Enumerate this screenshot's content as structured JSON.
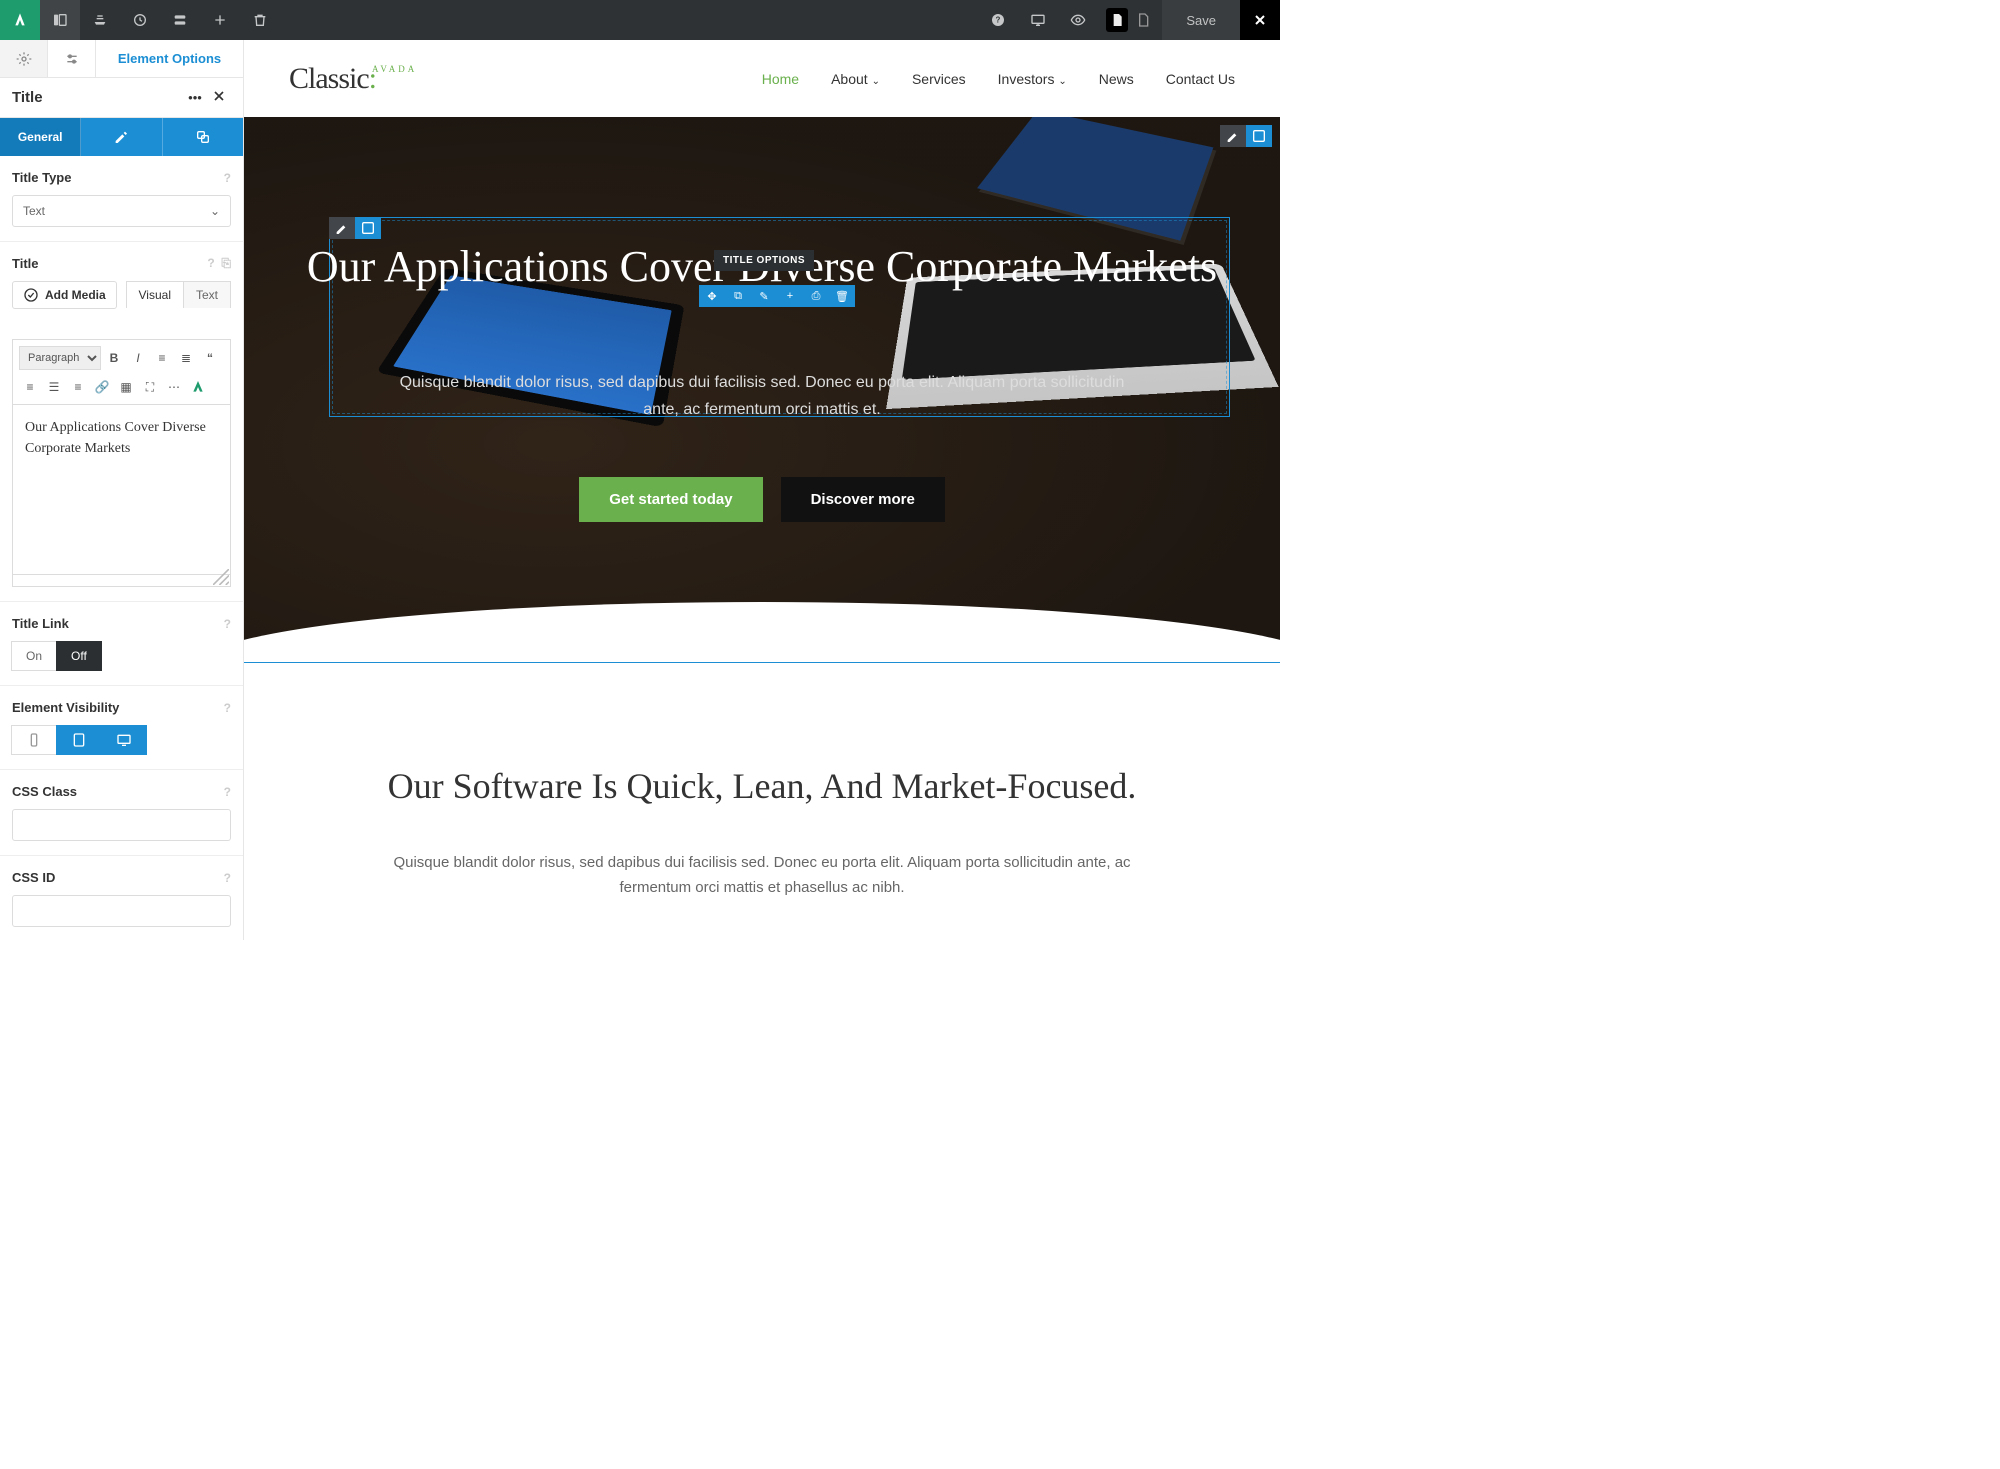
{
  "topbar": {
    "save": "Save"
  },
  "sidebar": {
    "elementOptionsTab": "Element Options",
    "title": "Title",
    "generalTab": "General",
    "fields": {
      "titleType": {
        "label": "Title Type",
        "value": "Text"
      },
      "titleEditor": {
        "label": "Title",
        "addMedia": "Add Media",
        "visual": "Visual",
        "text": "Text",
        "paragraph": "Paragraph",
        "content": "Our Applications Cover Diverse Corporate Markets"
      },
      "titleLink": {
        "label": "Title Link",
        "on": "On",
        "off": "Off"
      },
      "visibility": {
        "label": "Element Visibility"
      },
      "cssClass": {
        "label": "CSS Class"
      },
      "cssId": {
        "label": "CSS ID"
      }
    }
  },
  "preview": {
    "logo": {
      "text": "Classic",
      "sup": "AVADA"
    },
    "nav": [
      "Home",
      "About",
      "Services",
      "Investors",
      "News",
      "Contact Us"
    ],
    "hero": {
      "title": "Our Applications Cover Diverse Corporate Markets",
      "tooltip": "TITLE OPTIONS",
      "para": "Quisque blandit dolor risus, sed dapibus dui facilisis sed. Donec eu porta elit. Aliquam porta sollicitudin ante, ac fermentum orci mattis et.",
      "btn1": "Get started today",
      "btn2": "Discover more"
    },
    "section2": {
      "title": "Our Software Is Quick, Lean, And Market-Focused.",
      "para": "Quisque blandit dolor risus, sed dapibus dui facilisis sed. Donec eu porta elit. Aliquam porta sollicitudin ante, ac fermentum orci mattis et phasellus ac nibh."
    }
  }
}
